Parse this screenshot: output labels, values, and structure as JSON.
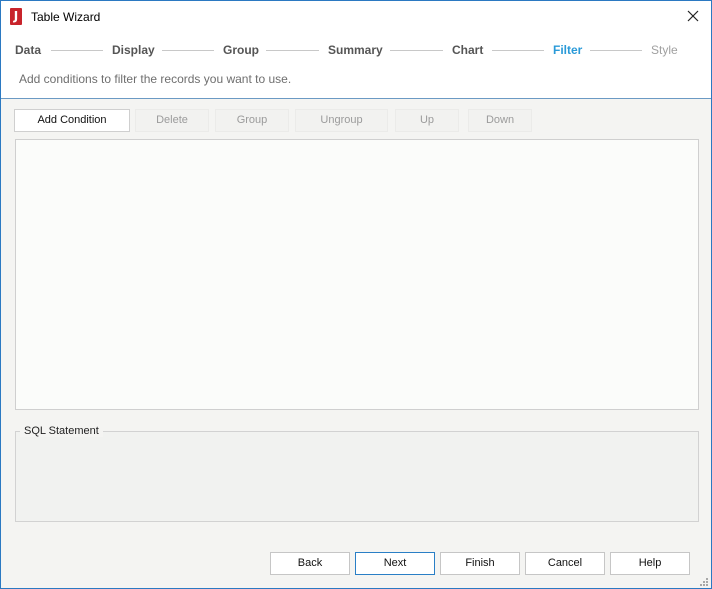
{
  "window": {
    "title": "Table Wizard",
    "app_icon_glyph": "J",
    "app_icon_color": "#c8242b",
    "close_icon": "close-icon"
  },
  "steps": [
    {
      "label": "Data",
      "state": "done"
    },
    {
      "label": "Display",
      "state": "done"
    },
    {
      "label": "Group",
      "state": "done"
    },
    {
      "label": "Summary",
      "state": "done"
    },
    {
      "label": "Chart",
      "state": "done"
    },
    {
      "label": "Filter",
      "state": "active"
    },
    {
      "label": "Style",
      "state": "future"
    }
  ],
  "subtitle": "Add conditions to filter the records you want to use.",
  "toolbar": {
    "add_condition": "Add Condition",
    "delete": "Delete",
    "group": "Group",
    "ungroup": "Ungroup",
    "up": "Up",
    "down": "Down"
  },
  "sql_statement": {
    "label": "SQL Statement",
    "value": ""
  },
  "footer": {
    "back": "Back",
    "next": "Next",
    "finish": "Finish",
    "cancel": "Cancel",
    "help": "Help"
  },
  "colors": {
    "active_step": "#2a9ad8",
    "window_border": "#2b79c2"
  }
}
